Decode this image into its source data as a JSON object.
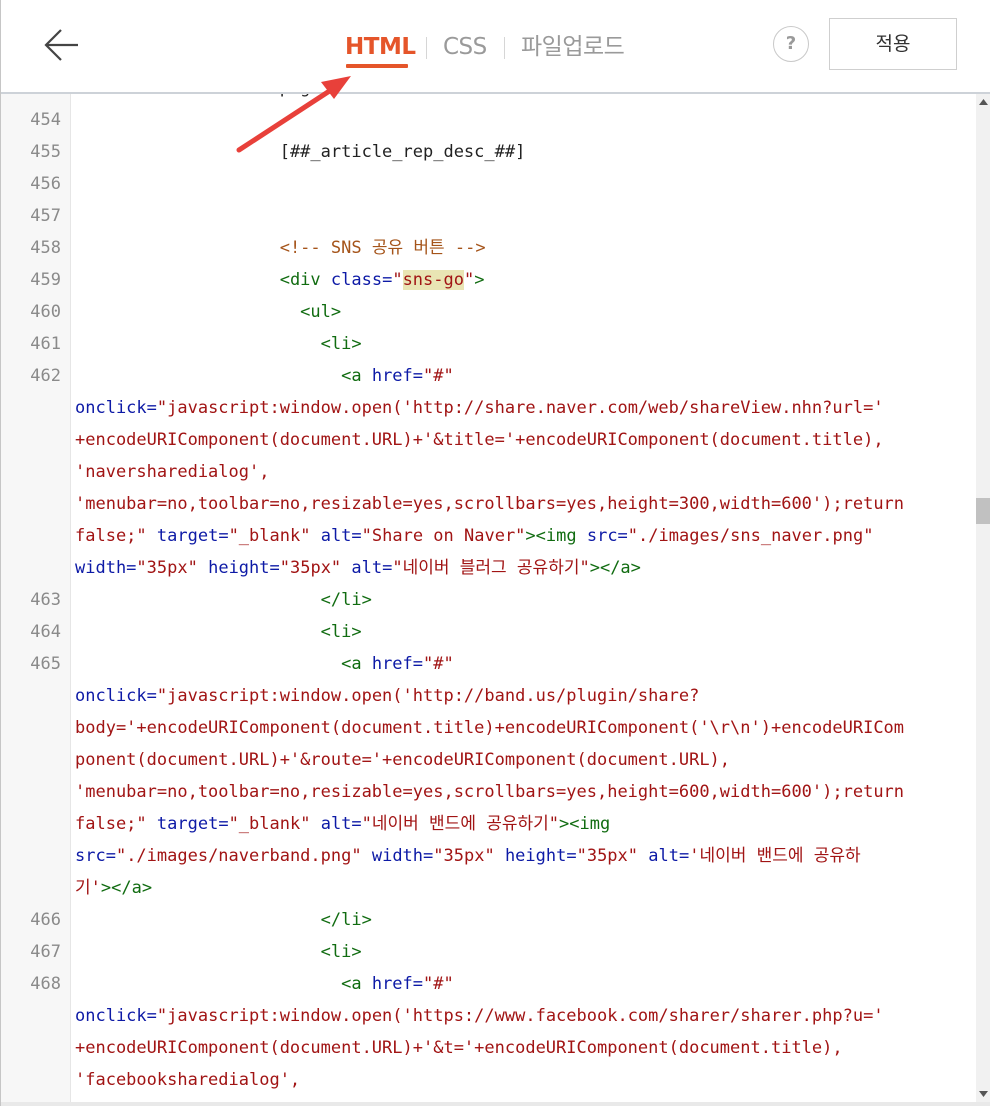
{
  "header": {
    "tabs": [
      {
        "label": "HTML",
        "active": true
      },
      {
        "label": "CSS",
        "active": false
      },
      {
        "label": "파일업로드",
        "active": false
      }
    ],
    "help_label": "?",
    "apply_label": "적용"
  },
  "icons": {
    "back": "arrow-left-icon",
    "annotation": "red-arrow-annotation"
  },
  "colors": {
    "accent": "#e5552a",
    "annotation_arrow": "#e8403a",
    "tag": "#116c11",
    "attribute": "#0d1aa6",
    "string": "#a11414",
    "comment": "#a5541a"
  },
  "editor": {
    "lines": [
      {
        "num": "",
        "tokens": [
          {
            "t": "c-txt",
            "v": "                    png"
          }
        ]
      },
      {
        "num": "454",
        "tokens": []
      },
      {
        "num": "455",
        "tokens": [
          {
            "t": "c-txt",
            "v": "                    [##_article_rep_desc_##]"
          }
        ]
      },
      {
        "num": "456",
        "tokens": []
      },
      {
        "num": "457",
        "tokens": []
      },
      {
        "num": "458",
        "tokens": [
          {
            "t": "c-txt",
            "v": "                    "
          },
          {
            "t": "c-cmt",
            "v": "<!-- SNS 공유 버튼 -->"
          }
        ]
      },
      {
        "num": "459",
        "tokens": [
          {
            "t": "c-txt",
            "v": "                    "
          },
          {
            "t": "c-tag",
            "v": "<div "
          },
          {
            "t": "c-attr",
            "v": "class="
          },
          {
            "t": "c-str",
            "v": "\""
          },
          {
            "t": "c-str hl",
            "v": "sns-go"
          },
          {
            "t": "c-str",
            "v": "\""
          },
          {
            "t": "c-tag",
            "v": ">"
          }
        ]
      },
      {
        "num": "460",
        "tokens": [
          {
            "t": "c-txt",
            "v": "                      "
          },
          {
            "t": "c-tag",
            "v": "<ul>"
          }
        ]
      },
      {
        "num": "461",
        "tokens": [
          {
            "t": "c-txt",
            "v": "                        "
          },
          {
            "t": "c-tag",
            "v": "<li>"
          }
        ]
      },
      {
        "num": "462",
        "tokens": [
          {
            "t": "c-txt",
            "v": "                          "
          },
          {
            "t": "c-tag",
            "v": "<a "
          },
          {
            "t": "c-attr",
            "v": "href="
          },
          {
            "t": "c-str",
            "v": "\"#\""
          },
          {
            "t": "c-txt",
            "v": "\n"
          },
          {
            "t": "c-attr",
            "v": "onclick="
          },
          {
            "t": "c-str",
            "v": "\"javascript:window.open('http://share.naver.com/web/shareView.nhn?url='\n+encodeURIComponent(document.URL)+'&title='+encodeURIComponent(document.title),\n'naversharedialog',\n'menubar=no,toolbar=no,resizable=yes,scrollbars=yes,height=300,width=600');return\nfalse;\""
          },
          {
            "t": "c-txt",
            "v": " "
          },
          {
            "t": "c-attr",
            "v": "target="
          },
          {
            "t": "c-str",
            "v": "\"_blank\""
          },
          {
            "t": "c-txt",
            "v": " "
          },
          {
            "t": "c-attr",
            "v": "alt="
          },
          {
            "t": "c-str",
            "v": "\"Share on Naver\""
          },
          {
            "t": "c-tag",
            "v": "><img "
          },
          {
            "t": "c-attr",
            "v": "src="
          },
          {
            "t": "c-str",
            "v": "\"./images/sns_naver.png\""
          },
          {
            "t": "c-txt",
            "v": "\n"
          },
          {
            "t": "c-attr",
            "v": "width="
          },
          {
            "t": "c-str",
            "v": "\"35px\""
          },
          {
            "t": "c-txt",
            "v": " "
          },
          {
            "t": "c-attr",
            "v": "height="
          },
          {
            "t": "c-str",
            "v": "\"35px\""
          },
          {
            "t": "c-txt",
            "v": " "
          },
          {
            "t": "c-attr",
            "v": "alt="
          },
          {
            "t": "c-str",
            "v": "\"네이버 블러그 공유하기\""
          },
          {
            "t": "c-tag",
            "v": "></a>"
          }
        ]
      },
      {
        "num": "463",
        "tokens": [
          {
            "t": "c-txt",
            "v": "                        "
          },
          {
            "t": "c-tag",
            "v": "</li>"
          }
        ]
      },
      {
        "num": "464",
        "tokens": [
          {
            "t": "c-txt",
            "v": "                        "
          },
          {
            "t": "c-tag",
            "v": "<li>"
          }
        ]
      },
      {
        "num": "465",
        "tokens": [
          {
            "t": "c-txt",
            "v": "                          "
          },
          {
            "t": "c-tag",
            "v": "<a "
          },
          {
            "t": "c-attr",
            "v": "href="
          },
          {
            "t": "c-str",
            "v": "\"#\""
          },
          {
            "t": "c-txt",
            "v": "\n"
          },
          {
            "t": "c-attr",
            "v": "onclick="
          },
          {
            "t": "c-str",
            "v": "\"javascript:window.open('http://band.us/plugin/share?\nbody='+encodeURIComponent(document.title)+encodeURIComponent('\\r\\n')+encodeURICom\nponent(document.URL)+'&route='+encodeURIComponent(document.URL),\n'menubar=no,toolbar=no,resizable=yes,scrollbars=yes,height=600,width=600');return\nfalse;\""
          },
          {
            "t": "c-txt",
            "v": " "
          },
          {
            "t": "c-attr",
            "v": "target="
          },
          {
            "t": "c-str",
            "v": "\"_blank\""
          },
          {
            "t": "c-txt",
            "v": " "
          },
          {
            "t": "c-attr",
            "v": "alt="
          },
          {
            "t": "c-str",
            "v": "\"네이버 밴드에 공유하기\""
          },
          {
            "t": "c-tag",
            "v": "><img"
          },
          {
            "t": "c-txt",
            "v": "\n"
          },
          {
            "t": "c-attr",
            "v": "src="
          },
          {
            "t": "c-str",
            "v": "\"./images/naverband.png\""
          },
          {
            "t": "c-txt",
            "v": " "
          },
          {
            "t": "c-attr",
            "v": "width="
          },
          {
            "t": "c-str",
            "v": "\"35px\""
          },
          {
            "t": "c-txt",
            "v": " "
          },
          {
            "t": "c-attr",
            "v": "height="
          },
          {
            "t": "c-str",
            "v": "\"35px\""
          },
          {
            "t": "c-txt",
            "v": " "
          },
          {
            "t": "c-attr",
            "v": "alt="
          },
          {
            "t": "c-str",
            "v": "'네이버 밴드에 공유하\n기'"
          },
          {
            "t": "c-tag",
            "v": "></a>"
          }
        ]
      },
      {
        "num": "466",
        "tokens": [
          {
            "t": "c-txt",
            "v": "                        "
          },
          {
            "t": "c-tag",
            "v": "</li>"
          }
        ]
      },
      {
        "num": "467",
        "tokens": [
          {
            "t": "c-txt",
            "v": "                        "
          },
          {
            "t": "c-tag",
            "v": "<li>"
          }
        ]
      },
      {
        "num": "468",
        "tokens": [
          {
            "t": "c-txt",
            "v": "                          "
          },
          {
            "t": "c-tag",
            "v": "<a "
          },
          {
            "t": "c-attr",
            "v": "href="
          },
          {
            "t": "c-str",
            "v": "\"#\""
          },
          {
            "t": "c-txt",
            "v": "\n"
          },
          {
            "t": "c-attr",
            "v": "onclick="
          },
          {
            "t": "c-str",
            "v": "\"javascript:window.open('https://www.facebook.com/sharer/sharer.php?u='\n+encodeURIComponent(document.URL)+'&t='+encodeURIComponent(document.title),\n'facebooksharedialog',"
          }
        ]
      }
    ]
  }
}
